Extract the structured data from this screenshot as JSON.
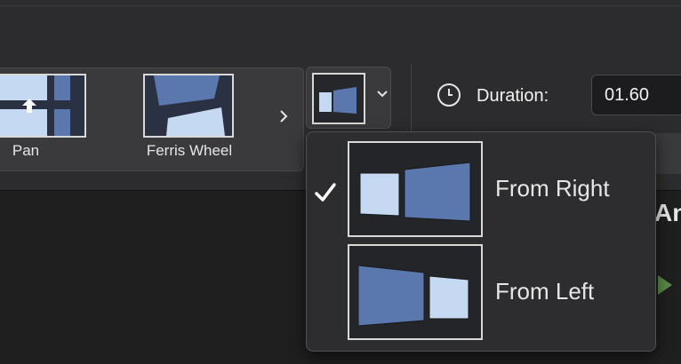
{
  "gallery": {
    "items": [
      {
        "label": "Pan"
      },
      {
        "label": "Ferris Wheel"
      }
    ],
    "next_icon": "chevron-right-icon"
  },
  "effect_options": {
    "button_icon": "chevron-down-icon",
    "items": [
      {
        "label": "From Right",
        "selected": true
      },
      {
        "label": "From Left",
        "selected": false
      }
    ]
  },
  "duration": {
    "label": "Duration:",
    "value": "01.60",
    "icon": "clock-icon"
  },
  "colors": {
    "panel_light": "#c5daf2",
    "panel_dark": "#5a78ae",
    "accent_play": "#5a8a4a"
  }
}
